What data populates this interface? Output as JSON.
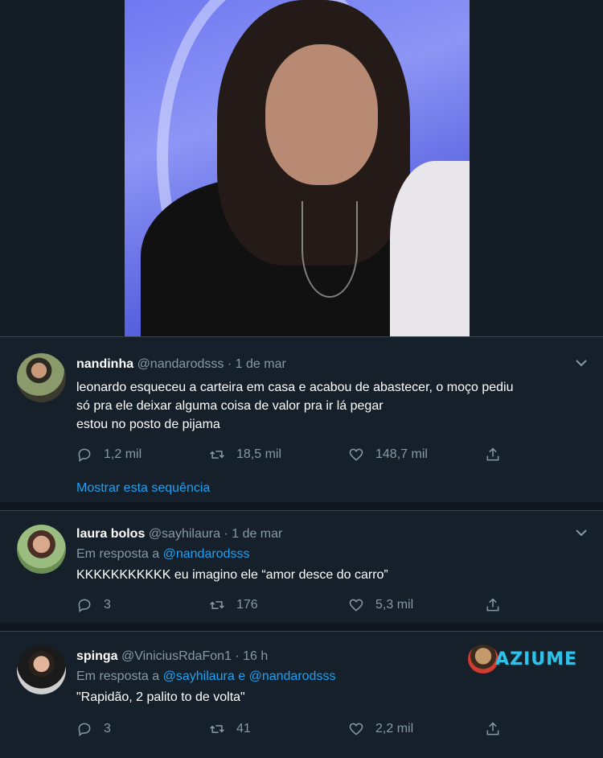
{
  "tweets": [
    {
      "name": "nandinha",
      "handle": "@nandarodsss",
      "date": "1 de mar",
      "text": "leonardo esqueceu a carteira em casa e acabou de abastecer, o moço pediu\nsó pra ele deixar alguma coisa de valor pra ir lá pegar\nestou no posto de pijama",
      "replies": "1,2 mil",
      "retweets": "18,5 mil",
      "likes": "148,7 mil",
      "show_thread": "Mostrar esta sequência"
    },
    {
      "name": "laura bolos",
      "handle": "@sayhilaura",
      "date": "1 de mar",
      "reply_prefix": "Em resposta a",
      "reply_mention_1": "@nandarodsss",
      "text": "KKKKKKKKKKK eu imagino ele “amor desce do carro”",
      "replies": "3",
      "retweets": "176",
      "likes": "5,3 mil"
    },
    {
      "name": "spinga",
      "handle": "@ViniciusRdaFon1",
      "date": "16 h",
      "reply_prefix": "Em resposta a",
      "reply_mention_1": "@sayhilaura",
      "reply_joiner": "e",
      "reply_mention_2": "@nandarodsss",
      "text": "\"Rapidão, 2 palito to de volta\"",
      "replies": "3",
      "retweets": "41",
      "likes": "2,2 mil"
    }
  ],
  "watermark": {
    "brand": "AZIUME"
  },
  "colors": {
    "background": "#15202b",
    "separator": "#10171e",
    "muted": "#8899a6",
    "link": "#1da1f2"
  },
  "icons": [
    "reply-icon",
    "retweet-icon",
    "like-icon",
    "share-icon",
    "chevron-down-icon"
  ]
}
